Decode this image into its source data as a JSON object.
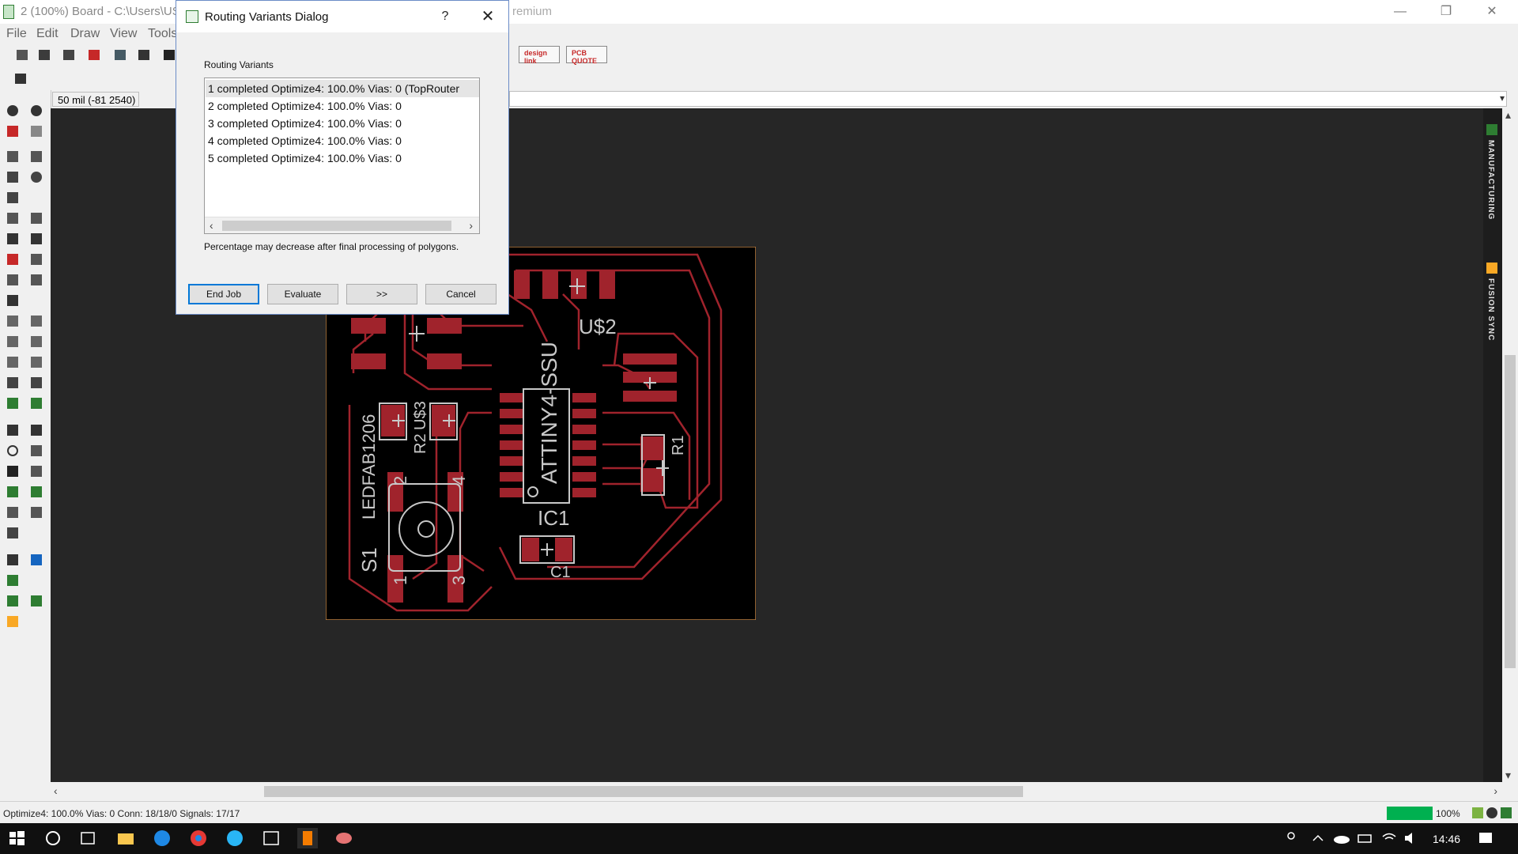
{
  "window": {
    "title": "2 (100%) Board - C:\\Users\\US",
    "title_tail": "remium",
    "minimize": "—",
    "restore": "❐",
    "close": "✕"
  },
  "menu": [
    "File",
    "Edit",
    "Draw",
    "View",
    "Tools"
  ],
  "toolbar": {
    "design_link": "design link",
    "pcb_quote": "PCB QUOTE"
  },
  "coordinate_display": "50 mil (-81 2540)",
  "command_line": {
    "value": ""
  },
  "side_tabs": [
    "MANUFACTURING",
    "FUSION SYNC"
  ],
  "pcb": {
    "labels": [
      "U$2",
      "ATTINY4-SSU",
      "IC1",
      "C1",
      "R1",
      "LEDFAB1206",
      "R2",
      "U$3",
      "S1",
      "2",
      "4",
      "1",
      "3"
    ]
  },
  "dialog": {
    "title": "Routing Variants Dialog",
    "help": "?",
    "close": "✕",
    "group_label": "Routing Variants",
    "variants": [
      "1 completed Optimize4:  100.0%  Vias: 0 (TopRouter",
      "2 completed Optimize4:  100.0%  Vias: 0",
      "3 completed Optimize4:  100.0%  Vias: 0",
      "4 completed Optimize4:  100.0%  Vias: 0",
      "5 completed Optimize4:  100.0%  Vias: 0"
    ],
    "selected_index": 0,
    "note": "Percentage may decrease after final processing of polygons.",
    "buttons": {
      "end_job": "End Job",
      "evaluate": "Evaluate",
      "next": ">>",
      "cancel": "Cancel"
    }
  },
  "status": {
    "text": "Optimize4: 100.0%  Vias: 0   Conn: 18/18/0   Signals: 17/17",
    "progress_percent": 100,
    "progress_label": "100%"
  },
  "taskbar": {
    "clock": "14:46"
  },
  "colors": {
    "canvas": "#262626",
    "copper": "#a0232c",
    "silkscreen": "#c8c8c8",
    "board_outline": "#c08040",
    "progress": "#00b050",
    "dialog_focus": "#0078d7"
  }
}
